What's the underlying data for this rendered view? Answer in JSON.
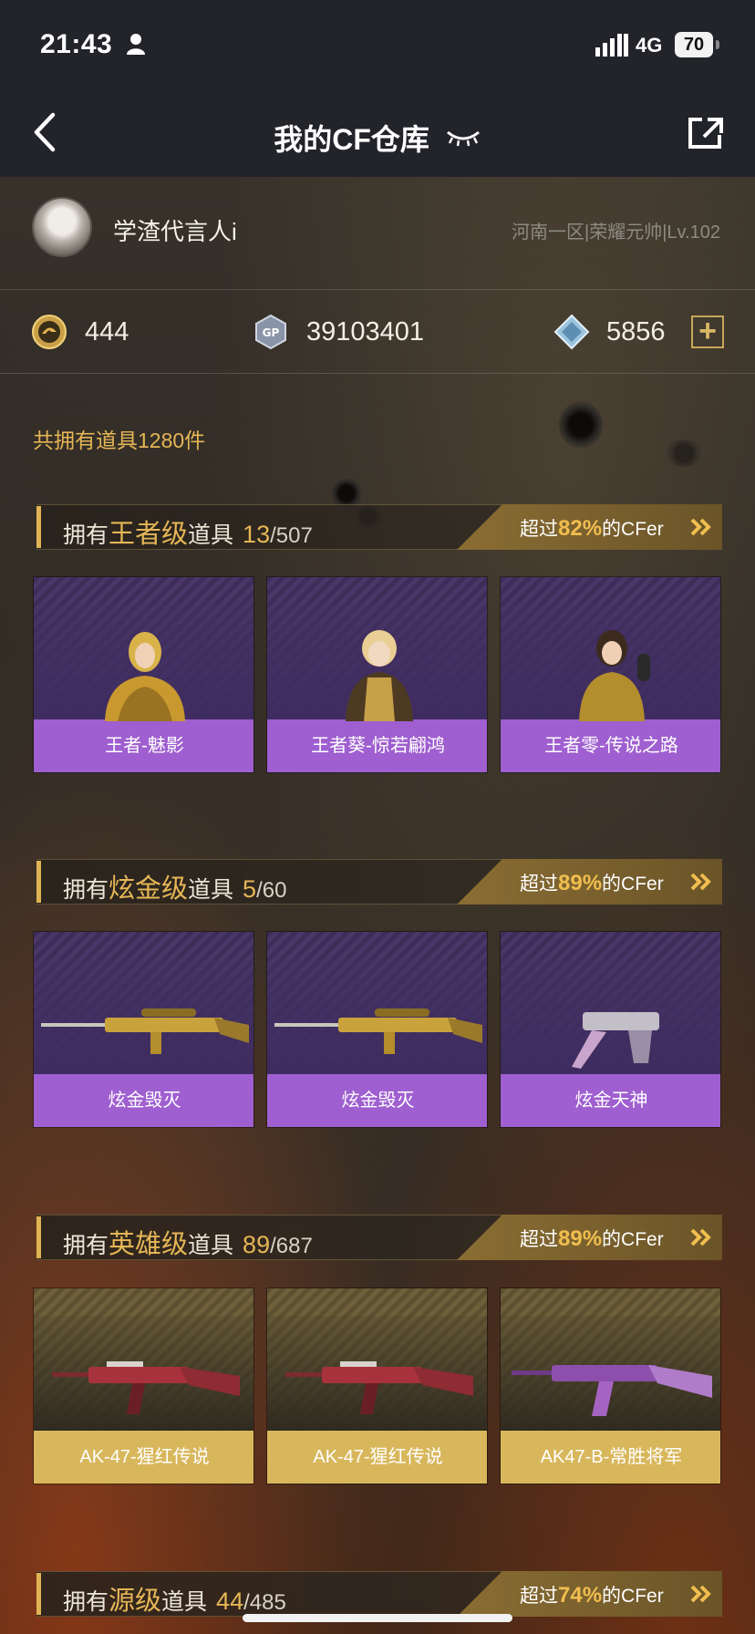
{
  "status_bar": {
    "time": "21:43",
    "network": "4G",
    "battery": "70"
  },
  "nav": {
    "title": "我的CF仓库"
  },
  "profile": {
    "nickname": "学渣代言人i",
    "server_info": "河南一区|荣耀元帅|Lv.102"
  },
  "currency": {
    "cf_points": "444",
    "gp": "39103401",
    "diamonds": "5856",
    "gp_badge": "GP"
  },
  "total": {
    "text": "共拥有道具1280件"
  },
  "sections": [
    {
      "prefix": "拥有",
      "tier": "王者级",
      "suffix": "道具",
      "owned": "13",
      "total": "/507",
      "rank_prefix": "超过",
      "rank_pct": "82%",
      "rank_suffix": "的CFer",
      "items": [
        {
          "name": "王者-魅影"
        },
        {
          "name": "王者葵-惊若翩鸿"
        },
        {
          "name": "王者零-传说之路"
        }
      ]
    },
    {
      "prefix": "拥有",
      "tier": "炫金级",
      "suffix": "道具",
      "owned": "5",
      "total": "/60",
      "rank_prefix": "超过",
      "rank_pct": "89%",
      "rank_suffix": "的CFer",
      "items": [
        {
          "name": "炫金毁灭"
        },
        {
          "name": "炫金毁灭"
        },
        {
          "name": "炫金天神"
        }
      ]
    },
    {
      "prefix": "拥有",
      "tier": "英雄级",
      "suffix": "道具",
      "owned": "89",
      "total": "/687",
      "rank_prefix": "超过",
      "rank_pct": "89%",
      "rank_suffix": "的CFer",
      "items": [
        {
          "name": "AK-47-猩红传说"
        },
        {
          "name": "AK-47-猩红传说"
        },
        {
          "name": "AK47-B-常胜将军"
        }
      ]
    },
    {
      "prefix": "拥有",
      "tier": "源级",
      "suffix": "道具",
      "owned": "44",
      "total": "/485",
      "rank_prefix": "超过",
      "rank_pct": "74%",
      "rank_suffix": "的CFer"
    }
  ],
  "colors": {
    "accent_gold": "#e5b656",
    "card_purple": "#9f5fd0",
    "card_gold": "#d8b75c",
    "nav_bg": "#23242a"
  },
  "icons": [
    "person-icon",
    "signal-icon",
    "back-icon",
    "eye-closed-icon",
    "share-icon",
    "cf-coin-icon",
    "gp-coin-icon",
    "diamond-icon",
    "plus-icon",
    "double-chevron-right-icon"
  ]
}
